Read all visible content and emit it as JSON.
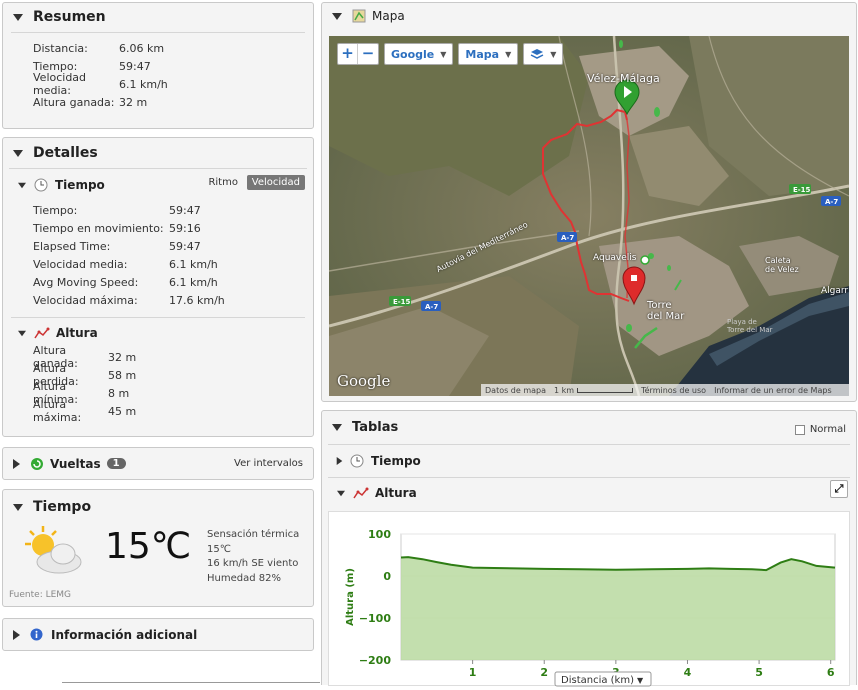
{
  "resumen": {
    "title": "Resumen",
    "rows": [
      {
        "label": "Distancia:",
        "value": "6.06 km"
      },
      {
        "label": "Tiempo:",
        "value": "59:47"
      },
      {
        "label": "Velocidad media:",
        "value": "6.1 km/h"
      },
      {
        "label": "Altura ganada:",
        "value": "32 m"
      }
    ]
  },
  "detalles": {
    "title": "Detalles",
    "tiempo": {
      "title": "Tiempo",
      "ritmo_label": "Ritmo",
      "velocidad_label": "Velocidad",
      "rows": [
        {
          "label": "Tiempo:",
          "value": "59:47"
        },
        {
          "label": "Tiempo en movimiento:",
          "value": "59:16"
        },
        {
          "label": "Elapsed Time:",
          "value": "59:47"
        },
        {
          "label": "Velocidad media:",
          "value": "6.1 km/h"
        },
        {
          "label": "Avg Moving Speed:",
          "value": "6.1 km/h"
        },
        {
          "label": "Velocidad máxima:",
          "value": "17.6 km/h"
        }
      ]
    },
    "altura": {
      "title": "Altura",
      "rows": [
        {
          "label": "Altura ganada:",
          "value": "32 m"
        },
        {
          "label": "Altura perdida:",
          "value": "58 m"
        },
        {
          "label": "Altura mínima:",
          "value": "8 m"
        },
        {
          "label": "Altura máxima:",
          "value": "45 m"
        }
      ]
    }
  },
  "vueltas": {
    "title": "Vueltas",
    "count": "1",
    "link": "Ver intervalos"
  },
  "weather": {
    "title": "Tiempo",
    "temp": "15℃",
    "feels": "Sensación térmica",
    "feels_value": "15℃",
    "wind": "16 km/h SE viento",
    "humidity": "Humedad 82%",
    "source": "Fuente: LEMG"
  },
  "info": {
    "title": "Información adicional"
  },
  "mapa": {
    "title": "Mapa",
    "provider": "Google",
    "maptype": "Mapa",
    "logo": "Google",
    "labels": {
      "velez": "Vélez-Málaga",
      "aquavelis": "Aquavelis",
      "torre": "Torre\ndel Mar",
      "caleta": "Caleta\nde Velez",
      "algarr": "Algarr",
      "playa": "Playa de\nTorre del Mar",
      "autovia": "Autovía del Mediterráneo"
    },
    "road": {
      "e15": "E-15",
      "a7": "A-7"
    },
    "footer": {
      "datos": "Datos de mapa",
      "scale": "1 km",
      "terminos": "Términos de uso",
      "error": "Informar de un error de Maps"
    }
  },
  "tablas": {
    "title": "Tablas",
    "normal": "Normal",
    "tiempo": "Tiempo",
    "altura": "Altura"
  },
  "chart_data": {
    "type": "area",
    "ylabel": "Altura (m)",
    "xlabel": "Distancia (km)",
    "xlim": [
      0,
      6.06
    ],
    "ylim": [
      -200,
      100
    ],
    "yticks": [
      "100",
      "0",
      "−100",
      "−200"
    ],
    "xticks": [
      "1",
      "2",
      "3",
      "4",
      "5",
      "6"
    ],
    "x": [
      0,
      0.1,
      0.3,
      0.5,
      0.7,
      1.0,
      1.3,
      1.6,
      2.0,
      2.5,
      3.0,
      3.5,
      4.0,
      4.3,
      4.6,
      4.9,
      5.1,
      5.3,
      5.45,
      5.6,
      5.8,
      6.06
    ],
    "y": [
      44,
      45,
      40,
      33,
      27,
      20,
      19,
      18,
      17,
      16,
      15,
      16,
      17,
      18,
      17,
      16,
      14,
      32,
      40,
      35,
      24,
      20
    ]
  }
}
